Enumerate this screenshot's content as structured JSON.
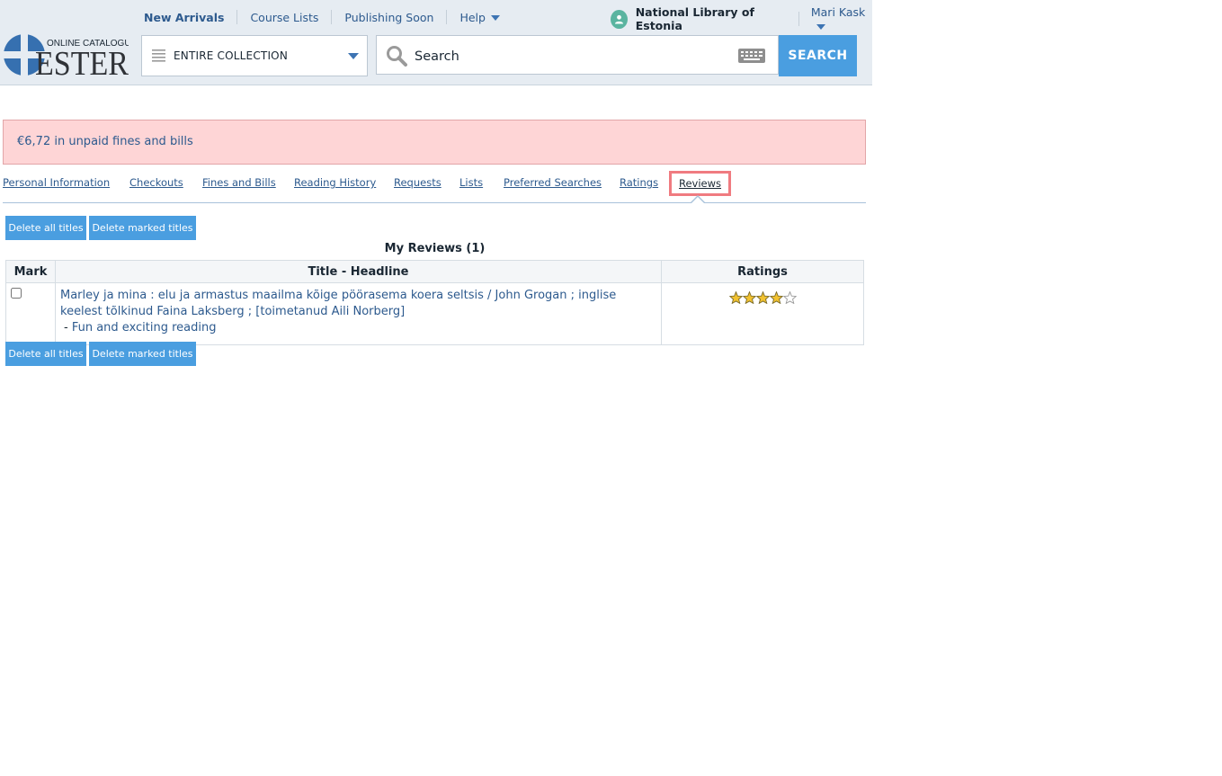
{
  "topnav": {
    "new_arrivals": "New Arrivals",
    "course_lists": "Course Lists",
    "publishing_soon": "Publishing Soon",
    "help": "Help"
  },
  "user": {
    "library": "National Library of Estonia",
    "name": "Mari Kask"
  },
  "logo": {
    "tagline": "ONLINE CATALOGUE",
    "name": "ESTER"
  },
  "search": {
    "collection": "ENTIRE COLLECTION",
    "placeholder": "Search",
    "button": "SEARCH"
  },
  "alert": {
    "message": "€6,72 in unpaid fines and bills"
  },
  "tabs": [
    {
      "label": "Personal Information"
    },
    {
      "label": "Checkouts"
    },
    {
      "label": "Fines and Bills"
    },
    {
      "label": "Reading History"
    },
    {
      "label": "Requests"
    },
    {
      "label": "Lists"
    },
    {
      "label": "Preferred Searches"
    },
    {
      "label": "Ratings"
    },
    {
      "label": "Reviews",
      "active": true
    }
  ],
  "actions": {
    "delete_all": "Delete all titles",
    "delete_marked": "Delete marked titles"
  },
  "reviews": {
    "caption": "My Reviews (1)",
    "columns": [
      "Mark",
      "Title - Headline",
      "Ratings"
    ],
    "rows": [
      {
        "checked": false,
        "title": "Marley ja mina : elu ja armastus maailma kõige pöörasema koera seltsis / John Grogan ; inglise keelest tõlkinud Faina Laksberg ; [toimetanud Aili Norberg]",
        "headline_prefix": "- ",
        "headline": "Fun and exciting reading",
        "rating": 4,
        "rating_max": 5
      }
    ]
  },
  "colors": {
    "accent": "#4a9ee0",
    "link": "#2d5a8e",
    "alert_bg": "#fed5d6",
    "active_tab_border": "#f07b80"
  }
}
